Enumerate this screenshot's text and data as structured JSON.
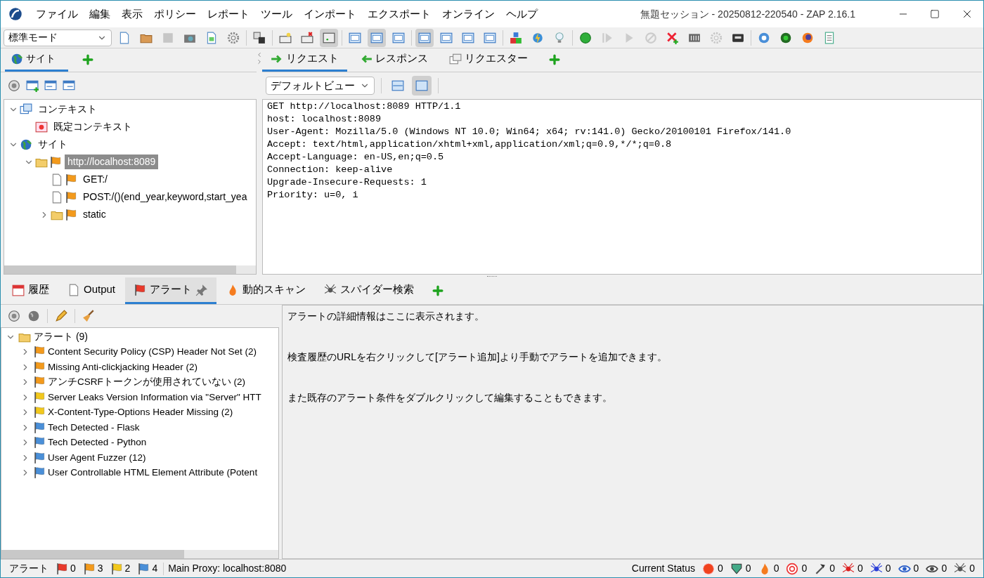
{
  "window": {
    "title": "無題セッション - 20250812-220540 - ZAP 2.16.1"
  },
  "menu": [
    "ファイル",
    "編集",
    "表示",
    "ポリシー",
    "レポート",
    "ツール",
    "インポート",
    "エクスポート",
    "オンライン",
    "ヘルプ"
  ],
  "toolbar": {
    "mode": "標準モード",
    "buttons": [
      {
        "kind": "button",
        "pressed": false,
        "disabled": false
      },
      {
        "kind": "button",
        "pressed": false,
        "disabled": false
      },
      {
        "kind": "button",
        "pressed": false,
        "disabled": true
      },
      {
        "kind": "button",
        "pressed": false,
        "disabled": false
      },
      {
        "kind": "button",
        "pressed": false,
        "disabled": false
      },
      {
        "kind": "button",
        "pressed": false,
        "disabled": false
      },
      {
        "kind": "separator"
      },
      {
        "kind": "button",
        "pressed": false,
        "disabled": false
      },
      {
        "kind": "separator"
      },
      {
        "kind": "button",
        "pressed": false,
        "disabled": false
      },
      {
        "kind": "button",
        "pressed": false,
        "disabled": false
      },
      {
        "kind": "button",
        "pressed": true,
        "disabled": false
      },
      {
        "kind": "separator"
      },
      {
        "kind": "button",
        "pressed": false,
        "disabled": false
      },
      {
        "kind": "button",
        "pressed": true,
        "disabled": false
      },
      {
        "kind": "button",
        "pressed": false,
        "disabled": false
      },
      {
        "kind": "separator"
      },
      {
        "kind": "button",
        "pressed": true,
        "disabled": false
      },
      {
        "kind": "button",
        "pressed": false,
        "disabled": false
      },
      {
        "kind": "button",
        "pressed": false,
        "disabled": false
      },
      {
        "kind": "button",
        "pressed": false,
        "disabled": false
      },
      {
        "kind": "separator"
      },
      {
        "kind": "button",
        "pressed": false,
        "disabled": false
      },
      {
        "kind": "button",
        "pressed": false,
        "disabled": false
      },
      {
        "kind": "button",
        "pressed": false,
        "disabled": false
      },
      {
        "kind": "separator"
      },
      {
        "kind": "button",
        "pressed": false,
        "disabled": false
      },
      {
        "kind": "button",
        "pressed": false,
        "disabled": true
      },
      {
        "kind": "button",
        "pressed": false,
        "disabled": true
      },
      {
        "kind": "button",
        "pressed": false,
        "disabled": true
      },
      {
        "kind": "button",
        "pressed": false,
        "disabled": false
      },
      {
        "kind": "button",
        "pressed": false,
        "disabled": false
      },
      {
        "kind": "button",
        "pressed": false,
        "disabled": true
      },
      {
        "kind": "button",
        "pressed": false,
        "disabled": false
      },
      {
        "kind": "separator"
      },
      {
        "kind": "button",
        "pressed": false,
        "disabled": false
      },
      {
        "kind": "button",
        "pressed": false,
        "disabled": false
      },
      {
        "kind": "button",
        "pressed": false,
        "disabled": false
      },
      {
        "kind": "button",
        "pressed": false,
        "disabled": false
      }
    ]
  },
  "left_tabs": [
    {
      "label": "サイト",
      "selected": true
    }
  ],
  "site_tree": [
    {
      "label": "コンテキスト",
      "kind": "contexts",
      "expanded": true,
      "selected": false,
      "children": [
        {
          "label": "既定コンテキスト",
          "kind": "context",
          "selected": false
        }
      ]
    },
    {
      "label": "サイト",
      "kind": "sites",
      "expanded": true,
      "selected": false,
      "children": [
        {
          "label": "http://localhost:8089",
          "kind": "site",
          "expanded": true,
          "selected": true,
          "children": [
            {
              "label": "GET:/",
              "kind": "page",
              "selected": false
            },
            {
              "label": "POST:/()(end_year,keyword,start_yea",
              "kind": "page",
              "selected": false
            },
            {
              "label": "static",
              "kind": "folder",
              "expanded": false,
              "selected": false
            }
          ]
        }
      ]
    }
  ],
  "request_tabs": [
    {
      "label": "リクエスト",
      "selected": true
    },
    {
      "label": "レスポンス",
      "selected": false
    },
    {
      "label": "リクエスター",
      "selected": false
    }
  ],
  "view_select": "デフォルトビュー",
  "view_buttons": [
    {
      "pressed": false
    },
    {
      "pressed": true
    }
  ],
  "request_lines": [
    "GET http://localhost:8089 HTTP/1.1",
    "host: localhost:8089",
    "User-Agent: Mozilla/5.0 (Windows NT 10.0; Win64; x64; rv:141.0) Gecko/20100101 Firefox/141.0",
    "Accept: text/html,application/xhtml+xml,application/xml;q=0.9,*/*;q=0.8",
    "Accept-Language: en-US,en;q=0.5",
    "Connection: keep-alive",
    "Upgrade-Insecure-Requests: 1",
    "Priority: u=0, i"
  ],
  "bottom_tabs": [
    {
      "label": "履歴",
      "kind": "history",
      "selected": false
    },
    {
      "label": "Output",
      "kind": "output",
      "selected": false
    },
    {
      "label": "アラート",
      "kind": "alerts",
      "selected": true
    },
    {
      "label": "動的スキャン",
      "kind": "scan",
      "selected": false
    },
    {
      "label": "スパイダー検索",
      "kind": "spider",
      "selected": false
    }
  ],
  "alert_tree": {
    "label": "アラート (9)",
    "expanded": true,
    "children": [
      {
        "label": "Content Security Policy (CSP) Header Not Set (2)",
        "color": "#f39a1c",
        "expanded": false
      },
      {
        "label": "Missing Anti-clickjacking Header (2)",
        "color": "#f39a1c",
        "expanded": false
      },
      {
        "label": "アンチCSRFトークンが使用されていない (2)",
        "color": "#f39a1c",
        "expanded": false
      },
      {
        "label": "Server Leaks Version Information via \"Server\" HTT",
        "color": "#f2c81d",
        "expanded": false
      },
      {
        "label": "X-Content-Type-Options Header Missing (2)",
        "color": "#f2c81d",
        "expanded": false
      },
      {
        "label": "Tech Detected - Flask",
        "color": "#4a8fd8",
        "expanded": false
      },
      {
        "label": "Tech Detected - Python",
        "color": "#4a8fd8",
        "expanded": false
      },
      {
        "label": "User Agent Fuzzer (12)",
        "color": "#4a8fd8",
        "expanded": false
      },
      {
        "label": "User Controllable HTML Element Attribute (Potent",
        "color": "#4a8fd8",
        "expanded": false
      }
    ]
  },
  "alert_detail": [
    "アラートの詳細情報はここに表示されます。",
    "検査履歴のURLを右クリックして[アラート追加]より手動でアラートを追加できます。",
    "また既存のアラート条件をダブルクリックして編集することもできます。"
  ],
  "status_bar": {
    "label": "アラート",
    "flags": [
      {
        "color": "#e8392b",
        "count": "0"
      },
      {
        "color": "#f39a1c",
        "count": "3"
      },
      {
        "color": "#f2c81d",
        "count": "2"
      },
      {
        "color": "#4a8fd8",
        "count": "4"
      }
    ],
    "proxy": "Main Proxy: localhost:8080",
    "current_status": "Current Status",
    "scan_counts": [
      {
        "kind": "scan",
        "count": "0"
      },
      {
        "kind": "download",
        "count": "0"
      },
      {
        "kind": "fire",
        "count": "0"
      },
      {
        "kind": "target",
        "count": "0"
      },
      {
        "kind": "hammer",
        "count": "0"
      },
      {
        "kind": "spider-red",
        "count": "0"
      },
      {
        "kind": "spider-blue",
        "count": "0"
      },
      {
        "kind": "eye-blue",
        "count": "0"
      },
      {
        "kind": "eye-grey",
        "count": "0"
      },
      {
        "kind": "spider-grey",
        "count": "0"
      }
    ]
  }
}
